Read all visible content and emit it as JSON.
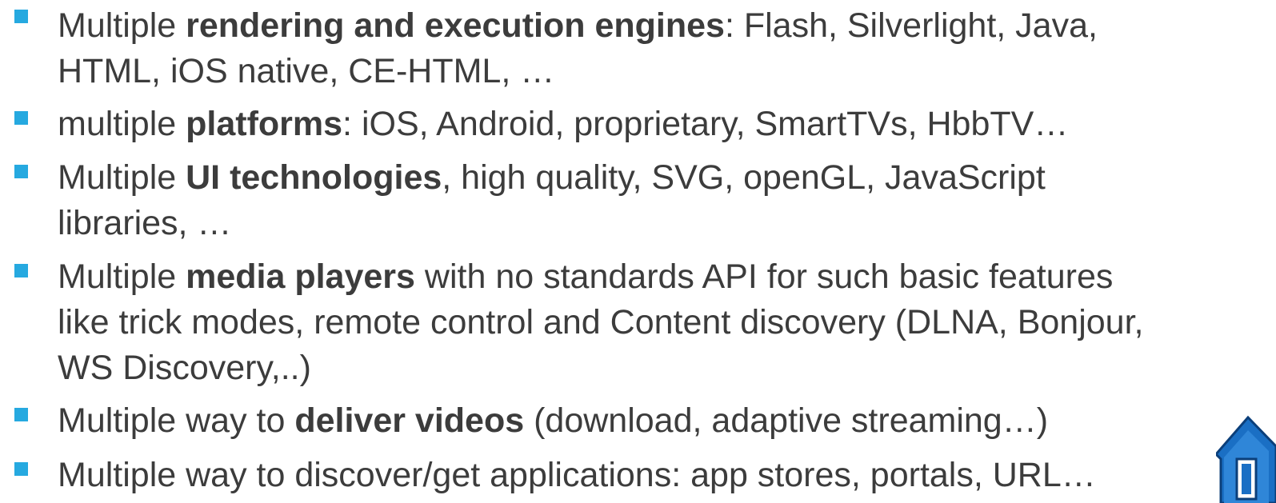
{
  "bullets": [
    {
      "lines": [
        [
          {
            "t": "Multiple "
          },
          {
            "t": "rendering and execution engines",
            "b": true
          },
          {
            "t": ": Flash, Silverlight, Java,"
          }
        ],
        [
          {
            "t": "HTML, iOS native, CE-HTML, …"
          }
        ]
      ]
    },
    {
      "lines": [
        [
          {
            "t": "multiple "
          },
          {
            "t": "platforms",
            "b": true
          },
          {
            "t": ": iOS, Android, proprietary, SmartTVs, HbbTV…"
          }
        ]
      ]
    },
    {
      "lines": [
        [
          {
            "t": "Multiple "
          },
          {
            "t": "UI technologies",
            "b": true
          },
          {
            "t": ", high quality, SVG, openGL, JavaScript"
          }
        ],
        [
          {
            "t": "libraries, …"
          }
        ]
      ]
    },
    {
      "lines": [
        [
          {
            "t": "Multiple "
          },
          {
            "t": "media players",
            "b": true
          },
          {
            "t": " with no standards API for such  basic features"
          }
        ],
        [
          {
            "t": "like trick modes, remote control and Content discovery (DLNA, Bonjour,"
          }
        ],
        [
          {
            "t": "WS Discovery,..)"
          }
        ]
      ]
    },
    {
      "lines": [
        [
          {
            "t": "Multiple way to "
          },
          {
            "t": "deliver videos",
            "b": true
          },
          {
            "t": " (download, adaptive streaming…)"
          }
        ]
      ]
    },
    {
      "lines": [
        [
          {
            "t": "Multiple way to discover/get applications: app stores, portals, URL…"
          }
        ]
      ]
    }
  ],
  "colors": {
    "bullet_marker": "#26a9e0",
    "text": "#3c3c3c",
    "icon_blue": "#1a6fc4"
  },
  "icons": {
    "corner": "home-icon"
  }
}
